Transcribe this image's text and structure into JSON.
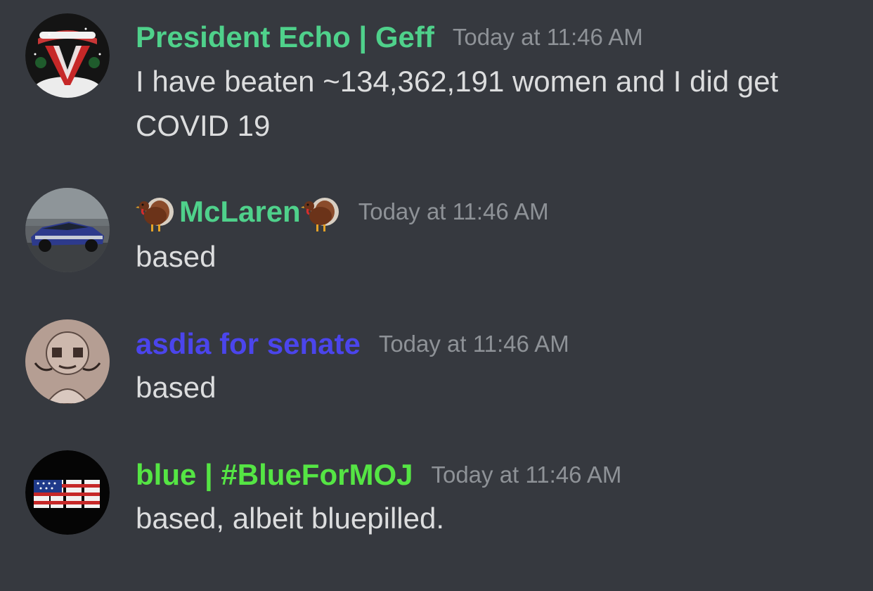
{
  "colors": {
    "background": "#36393f",
    "timestamp": "#8e9297",
    "text": "#dcddde"
  },
  "messages": [
    {
      "author": "President Echo | Geff",
      "author_color": "#4fd18b",
      "avatar_icon": "v-logo-santa-hat-avatar",
      "timestamp": "Today at 11:46 AM",
      "content": "I have beaten ~134,362,191 women and I did get COVID 19"
    },
    {
      "author": "McLaren",
      "author_color": "#4fd18b",
      "author_emoji_left": "turkey-emoji",
      "author_emoji_right": "turkey-emoji",
      "avatar_icon": "race-car-avatar",
      "timestamp": "Today at 11:46 AM",
      "content": "based"
    },
    {
      "author": "asdia for senate",
      "author_color": "#4b45ec",
      "avatar_icon": "sketch-character-avatar",
      "timestamp": "Today at 11:46 AM",
      "content": "based"
    },
    {
      "author": "blue | #BlueForMOJ",
      "author_color": "#55e544",
      "avatar_icon": "flag-text-avatar",
      "timestamp": "Today at 11:46 AM",
      "content": "based, albeit bluepilled."
    }
  ]
}
